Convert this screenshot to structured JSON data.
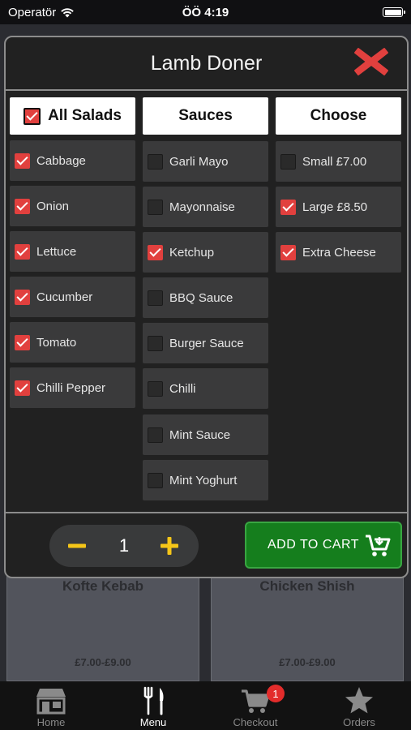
{
  "status": {
    "carrier": "Operatör",
    "time": "ÖÖ 4:19"
  },
  "modal": {
    "title": "Lamb Doner"
  },
  "columns": [
    {
      "header": "All Salads",
      "header_checkbox": true,
      "items": [
        {
          "label": "Cabbage",
          "checked": true
        },
        {
          "label": "Onion",
          "checked": true
        },
        {
          "label": "Lettuce",
          "checked": true
        },
        {
          "label": "Cucumber",
          "checked": true
        },
        {
          "label": "Tomato",
          "checked": true
        },
        {
          "label": "Chilli Pepper",
          "checked": true
        }
      ]
    },
    {
      "header": "Sauces",
      "header_checkbox": false,
      "items": [
        {
          "label": "Garli Mayo",
          "checked": false
        },
        {
          "label": "Mayonnaise",
          "checked": false
        },
        {
          "label": "Ketchup",
          "checked": true
        },
        {
          "label": "BBQ Sauce",
          "checked": false
        },
        {
          "label": "Burger Sauce",
          "checked": false
        },
        {
          "label": "Chilli",
          "checked": false
        },
        {
          "label": "Mint Sauce",
          "checked": false
        },
        {
          "label": "Mint Yoghurt",
          "checked": false
        }
      ]
    },
    {
      "header": "Choose",
      "header_checkbox": false,
      "items": [
        {
          "label": "Small £7.00",
          "checked": false
        },
        {
          "label": "Large £8.50",
          "checked": true
        },
        {
          "label": "Extra Cheese",
          "checked": true
        }
      ]
    }
  ],
  "quantity": "1",
  "add_to_cart_label": "ADD TO CART",
  "background_menu": [
    {
      "name": "Kofte Kebab",
      "price": "£7.00-£9.00"
    },
    {
      "name": "Chicken Shish",
      "price": "£7.00-£9.00"
    }
  ],
  "tabs": [
    {
      "label": "Home",
      "icon": "store-icon",
      "active": false
    },
    {
      "label": "Menu",
      "icon": "fork-knife-icon",
      "active": true
    },
    {
      "label": "Checkout",
      "icon": "cart-icon",
      "active": false,
      "badge": "1"
    },
    {
      "label": "Orders",
      "icon": "star-icon",
      "active": false
    }
  ],
  "colors": {
    "accent_red": "#e1403e",
    "cart_green": "#157e1d",
    "stepper_yellow": "#f5c518"
  }
}
